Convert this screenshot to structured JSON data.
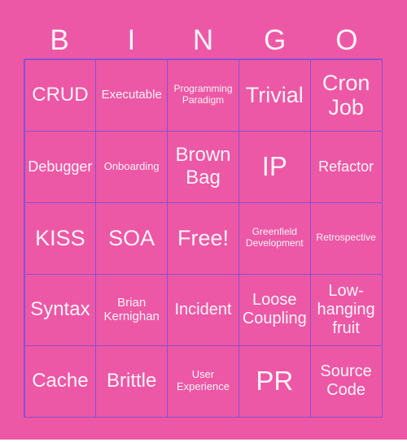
{
  "header": [
    "B",
    "I",
    "N",
    "G",
    "O"
  ],
  "cells": [
    [
      "CRUD",
      "Executable",
      "Programming Paradigm",
      "Trivial",
      "Cron Job"
    ],
    [
      "Debugger",
      "Onboarding",
      "Brown Bag",
      "IP",
      "Refactor"
    ],
    [
      "KISS",
      "SOA",
      "Free!",
      "Greenfield Development",
      "Retrospective"
    ],
    [
      "Syntax",
      "Brian Kernighan",
      "Incident",
      "Loose Coupling",
      "Low-hanging fruit"
    ],
    [
      "Cache",
      "Brittle",
      "User Experience",
      "PR",
      "Source Code"
    ]
  ],
  "colors": {
    "background": "#ec58a6",
    "grid_line": "#8a4fd0",
    "text": "#fdf3f6"
  }
}
